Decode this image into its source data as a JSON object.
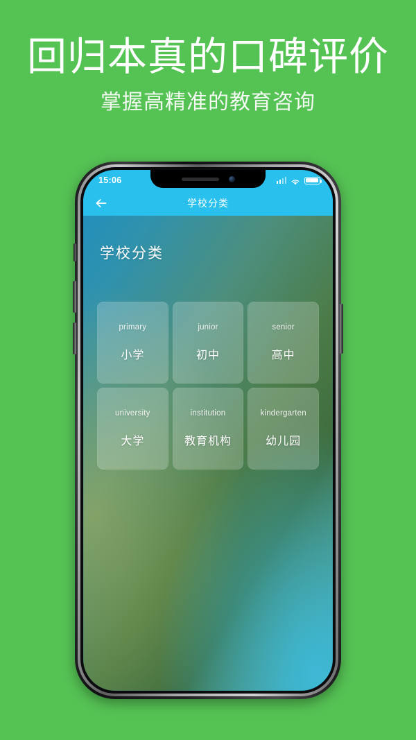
{
  "promo": {
    "headline": "回归本真的口碑评价",
    "subheadline": "掌握高精准的教育咨询",
    "background_color": "#55c254"
  },
  "phone": {
    "status_bar": {
      "time": "15:06",
      "signal_icon": "signal-bars-icon",
      "wifi_icon": "wifi-icon",
      "battery_icon": "battery-full-icon"
    },
    "nav_bar": {
      "back_icon": "back-arrow-icon",
      "title": "学校分类",
      "background_color": "#29c0ee"
    },
    "screen": {
      "page_heading": "学校分类",
      "categories": [
        {
          "en": "primary",
          "cn": "小学"
        },
        {
          "en": "junior",
          "cn": "初中"
        },
        {
          "en": "senior",
          "cn": "高中"
        },
        {
          "en": "university",
          "cn": "大学"
        },
        {
          "en": "institution",
          "cn": "教育机构"
        },
        {
          "en": "kindergarten",
          "cn": "幼儿园"
        }
      ]
    },
    "hardware": {
      "notch_speaker": "speaker-grille",
      "notch_camera": "front-camera-icon",
      "silence_switch": "silence-switch-button",
      "volume_up": "volume-up-button",
      "volume_down": "volume-down-button",
      "power": "power-button"
    }
  }
}
